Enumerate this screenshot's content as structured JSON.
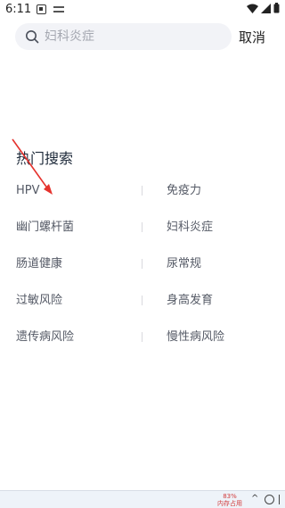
{
  "status_bar": {
    "time": "6:11"
  },
  "search": {
    "placeholder": "妇科炎症",
    "cancel_label": "取消"
  },
  "hot_search": {
    "title": "热门搜索",
    "items": [
      {
        "left": "HPV",
        "right": "免疫力"
      },
      {
        "left": "幽门螺杆菌",
        "right": "妇科炎症"
      },
      {
        "left": "肠道健康",
        "right": "尿常规"
      },
      {
        "left": "过敏风险",
        "right": "身高发育"
      },
      {
        "left": "遗传病风险",
        "right": "慢性病风险"
      }
    ]
  },
  "taskbar": {
    "memory_percent": "83%",
    "memory_label": "内存占用"
  },
  "colors": {
    "annotation_arrow": "#e5322d",
    "search_bg": "#f2f3f7"
  }
}
